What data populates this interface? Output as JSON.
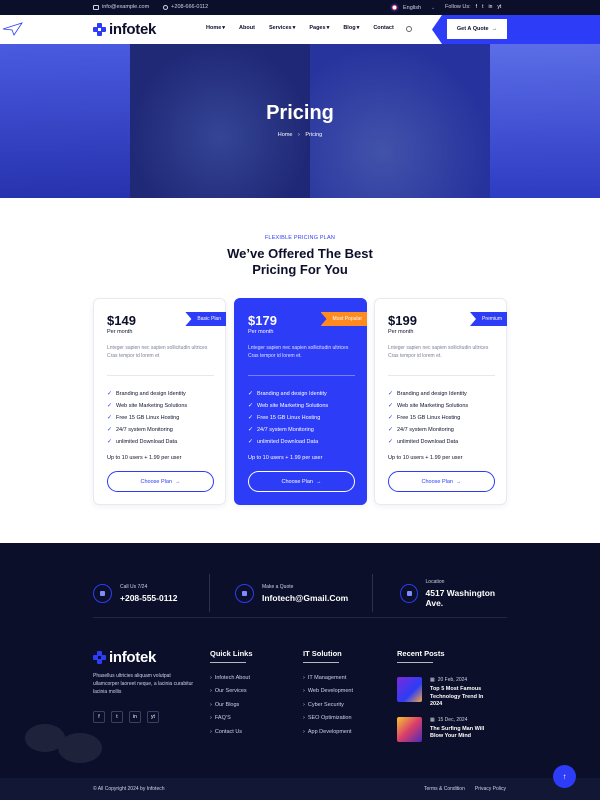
{
  "topbar": {
    "email": "info@example.com",
    "phone": "+208-666-0112",
    "language": "English",
    "follow_label": "Follow Us:",
    "social": [
      "f",
      "t",
      "in",
      "yt"
    ]
  },
  "header": {
    "logo": "infotek",
    "nav": [
      {
        "label": "Home",
        "dropdown": true
      },
      {
        "label": "About",
        "dropdown": false
      },
      {
        "label": "Services",
        "dropdown": true
      },
      {
        "label": "Pages",
        "dropdown": true
      },
      {
        "label": "Blog",
        "dropdown": true
      },
      {
        "label": "Contact",
        "dropdown": false
      }
    ],
    "cta": "Get A Quote",
    "accent_color": "#2d3cf6"
  },
  "hero": {
    "title": "Pricing",
    "breadcrumb_home": "Home",
    "breadcrumb_current": "Pricing"
  },
  "pricing": {
    "eyebrow": "FLEXIBLE PRICING PLAN",
    "title_line1": "We’ve Offered The Best",
    "title_line2": "Pricing For You",
    "plans": [
      {
        "price": "$149",
        "period": "Per month",
        "badge": "Basic Plan",
        "description": "Lnteger sapien nec sapien sollicitudin ultrices Cras tempor id lorem et",
        "features": [
          "Branding and design Identity",
          "Web site Marketing Solutions",
          "Free 15 GB Linux Hosting",
          "24/7 system Monitoring",
          "unlimited Download Data"
        ],
        "users": "Up to 10 users + 1.99 per user",
        "button": "Choose Plan"
      },
      {
        "price": "$179",
        "period": "Per month",
        "badge": "Most Popular",
        "description": "Lnteger sapien nec sapien sollicitudin ultrices Cras tempor id lorem et.",
        "features": [
          "Branding and design Identity",
          "Web site Marketing Solutions",
          "Free 15 GB Linux Hosting",
          "24/7 system Monitoring",
          "unlimited Download Data"
        ],
        "users": "Up to 10 users + 1.99 per user",
        "button": "Choose Plan"
      },
      {
        "price": "$199",
        "period": "Per month",
        "badge": "Premium",
        "description": "Lnteger sapien nec sapien sollicitudin ultrices Cras tempor id lorem et.",
        "features": [
          "Branding and design Identity",
          "Web site Marketing Solutions",
          "Free 15 GB Linux Hosting",
          "24/7 system Monitoring",
          "unlimited Download Data"
        ],
        "users": "Up to 10 users + 1.99 per user",
        "button": "Choose Plan"
      }
    ]
  },
  "footer": {
    "contacts": [
      {
        "label": "Call Us 7/24",
        "value": "+208-555-0112",
        "icon": "phone-icon"
      },
      {
        "label": "Make a Quote",
        "value": "Infotech@Gmail.Com",
        "icon": "mail-icon"
      },
      {
        "label": "Location",
        "value": "4517 Washington Ave.",
        "icon": "location-icon"
      }
    ],
    "logo": "infotek",
    "about": "Phasellus ultricies aliquam volutpat ullamcorper laoreet neque, a lacinia curabitur lacinia mollis",
    "social": [
      "f",
      "t",
      "in",
      "yt"
    ],
    "quick_links_title": "Quick Links",
    "quick_links": [
      "Infotech About",
      "Our Services",
      "Our Blogs",
      "FAQ’S",
      "Contact Us"
    ],
    "it_solution_title": "IT Solution",
    "it_solution": [
      "IT Management",
      "Web Development",
      "Cyber Security",
      "SEO Optimization",
      "App Development"
    ],
    "recent_posts_title": "Recent Posts",
    "posts": [
      {
        "date": "20 Feb, 2024",
        "title": "Top 5 Most Famous Technology Trend In 2024"
      },
      {
        "date": "15 Dec, 2024",
        "title": "The Surfing Man Will Blow Your Mind"
      }
    ],
    "copyright": "© All Copyright 2024 by Infotech",
    "bottom_links": [
      "Terms & Condition",
      "Privacy Policy"
    ],
    "background_color": "#0b0f2a"
  }
}
